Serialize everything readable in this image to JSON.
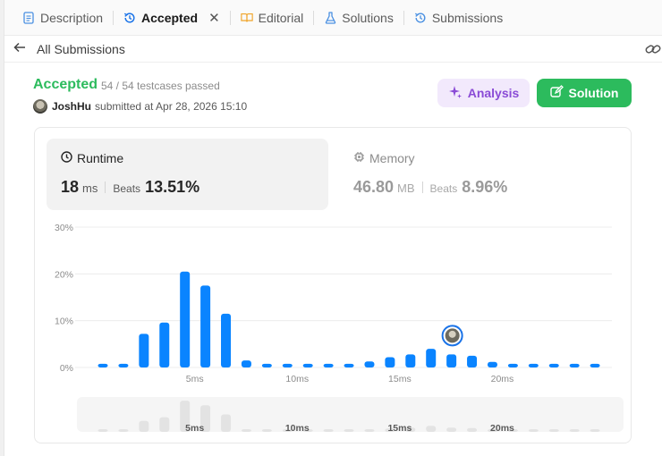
{
  "tabs": [
    {
      "label": "Description",
      "icon": "description-icon"
    },
    {
      "label": "Accepted",
      "icon": "history-icon",
      "active": true
    },
    {
      "label": "Editorial",
      "icon": "book-icon"
    },
    {
      "label": "Solutions",
      "icon": "flask-icon"
    },
    {
      "label": "Submissions",
      "icon": "history-icon"
    }
  ],
  "back": {
    "label": "All Submissions"
  },
  "submission": {
    "status": "Accepted",
    "testcases": "54 / 54 testcases passed",
    "author": "JoshHu",
    "submitted": "submitted at Apr 28, 2026 15:10"
  },
  "buttons": {
    "analysis": "Analysis",
    "solution": "Solution"
  },
  "runtime": {
    "title": "Runtime",
    "value": "18",
    "unit": "ms",
    "beats_label": "Beats",
    "beats": "13.51%"
  },
  "memory": {
    "title": "Memory",
    "value": "46.80",
    "unit": "MB",
    "beats_label": "Beats",
    "beats": "8.96%"
  },
  "colors": {
    "accent_green": "#2cbb5d",
    "bar_blue": "#0a84ff",
    "analysis_purple": "#8a4bd6"
  },
  "chart_data": {
    "type": "bar",
    "x": [
      1,
      2,
      3,
      4,
      5,
      6,
      7,
      8,
      9,
      10,
      11,
      12,
      13,
      14,
      15,
      16,
      17,
      18,
      19,
      20,
      21,
      22,
      23,
      24,
      25
    ],
    "values": [
      0.8,
      0.8,
      7.2,
      9.6,
      20.5,
      17.5,
      11.5,
      1.5,
      0.8,
      0.8,
      0.8,
      0.8,
      0.8,
      1.3,
      2.2,
      2.8,
      4.0,
      2.8,
      2.5,
      1.2,
      0.8,
      0.8,
      0.8,
      0.8,
      0.8
    ],
    "ylim": [
      0,
      30
    ],
    "yticks": [
      "0%",
      "10%",
      "20%",
      "30%"
    ],
    "ytick_values": [
      0,
      10,
      20,
      30
    ],
    "xticks": [
      "5ms",
      "10ms",
      "15ms",
      "20ms"
    ],
    "xtick_values": [
      5,
      10,
      15,
      20
    ],
    "highlight_x": 18,
    "grid": true
  }
}
